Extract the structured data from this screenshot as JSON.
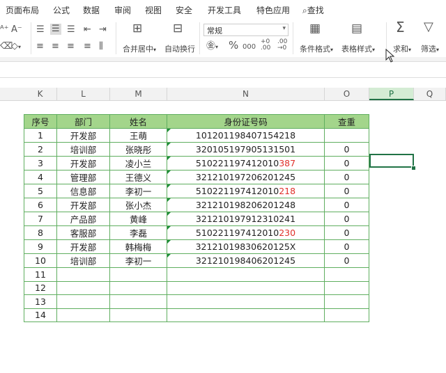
{
  "menu": [
    "页面布局",
    "公式",
    "数据",
    "审阅",
    "视图",
    "安全",
    "开发工具",
    "特色应用",
    "查找"
  ],
  "ribbon": {
    "merge_label": "合并居中",
    "wrap_label": "自动换行",
    "number_format": "常规",
    "cond_format_label": "条件格式",
    "table_style_label": "表格样式",
    "sum_label": "求和",
    "filter_label": "筛选",
    "percent_symbol": "%",
    "comma_symbol": "000"
  },
  "columns": [
    "K",
    "L",
    "M",
    "N",
    "O",
    "P",
    "Q"
  ],
  "selected_column": "P",
  "table": {
    "headers": [
      "序号",
      "部门",
      "姓名",
      "身份证号码",
      "查重"
    ],
    "rows": [
      {
        "n": "1",
        "dept": "开发部",
        "name": "王萌",
        "id_a": "101201198407154218",
        "id_b": "",
        "check": ""
      },
      {
        "n": "2",
        "dept": "培训部",
        "name": "张晓彤",
        "id_a": "320105197905131501",
        "id_b": "",
        "check": "0"
      },
      {
        "n": "3",
        "dept": "开发部",
        "name": "凌小兰",
        "id_a": "510221197412010",
        "id_b": "387",
        "check": "0"
      },
      {
        "n": "4",
        "dept": "管理部",
        "name": "王德义",
        "id_a": "321210197206201245",
        "id_b": "",
        "check": "0"
      },
      {
        "n": "5",
        "dept": "信息部",
        "name": "李初一",
        "id_a": "510221197412010",
        "id_b": "218",
        "check": "0"
      },
      {
        "n": "6",
        "dept": "开发部",
        "name": "张小杰",
        "id_a": "321210198206201248",
        "id_b": "",
        "check": "0"
      },
      {
        "n": "7",
        "dept": "产品部",
        "name": "黄峰",
        "id_a": "321210197912310241",
        "id_b": "",
        "check": "0"
      },
      {
        "n": "8",
        "dept": "客服部",
        "name": "李磊",
        "id_a": "510221197412010",
        "id_b": "230",
        "check": "0"
      },
      {
        "n": "9",
        "dept": "开发部",
        "name": "韩梅梅",
        "id_a": "32121019830620125X",
        "id_b": "",
        "check": "0"
      },
      {
        "n": "10",
        "dept": "培训部",
        "name": "李初一",
        "id_a": "321210198406201245",
        "id_b": "",
        "check": "0"
      },
      {
        "n": "11",
        "dept": "",
        "name": "",
        "id_a": "",
        "id_b": "",
        "check": ""
      },
      {
        "n": "12",
        "dept": "",
        "name": "",
        "id_a": "",
        "id_b": "",
        "check": ""
      },
      {
        "n": "13",
        "dept": "",
        "name": "",
        "id_a": "",
        "id_b": "",
        "check": ""
      },
      {
        "n": "14",
        "dept": "",
        "name": "",
        "id_a": "",
        "id_b": "",
        "check": ""
      }
    ]
  },
  "colors": {
    "header_fill": "#a3d58b",
    "border": "#5fae5f",
    "highlight_text": "#e0302a",
    "selection": "#217346"
  }
}
